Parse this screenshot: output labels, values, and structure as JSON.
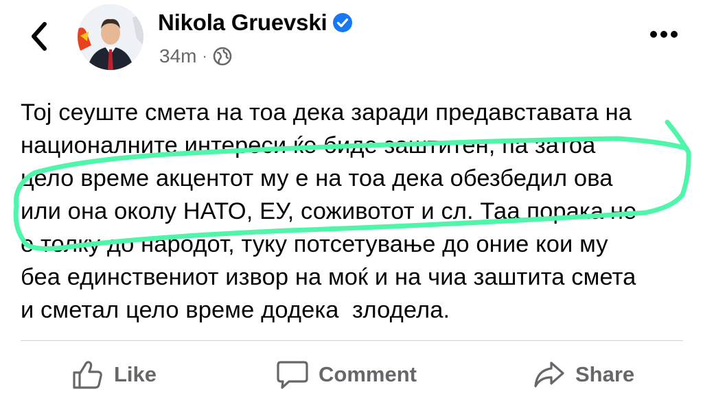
{
  "post": {
    "author": "Nikola Gruevski",
    "time": "34m",
    "separator": "·",
    "text": "Тој сеуште смета на тоа дека заради предавставата на\nнационалните интереси ќе биде заштитен, па затоа\nцело време акцентот му е на тоа дека обезбедил ова\nили она околу НАТО, ЕУ, соживотот и сл. Таа порака не\nе толку до народот, туку потсетување до оние кои му\nбеа единствениот извор на моќ и на чиа заштита смета\nи сметал цело време додека  злодела."
  },
  "actions": {
    "like": "Like",
    "comment": "Comment",
    "share": "Share"
  },
  "icons": {
    "back": "chevron-left-icon",
    "verified": "verified-badge-icon",
    "audience": "globe-icon",
    "more": "more-dots-icon",
    "like": "thumbs-up-icon",
    "comment": "comment-bubble-icon",
    "share": "share-arrow-icon"
  },
  "colors": {
    "verified": "#1877f2",
    "secondary_text": "#65676b",
    "annotation_stroke": "#4ff5a8"
  }
}
